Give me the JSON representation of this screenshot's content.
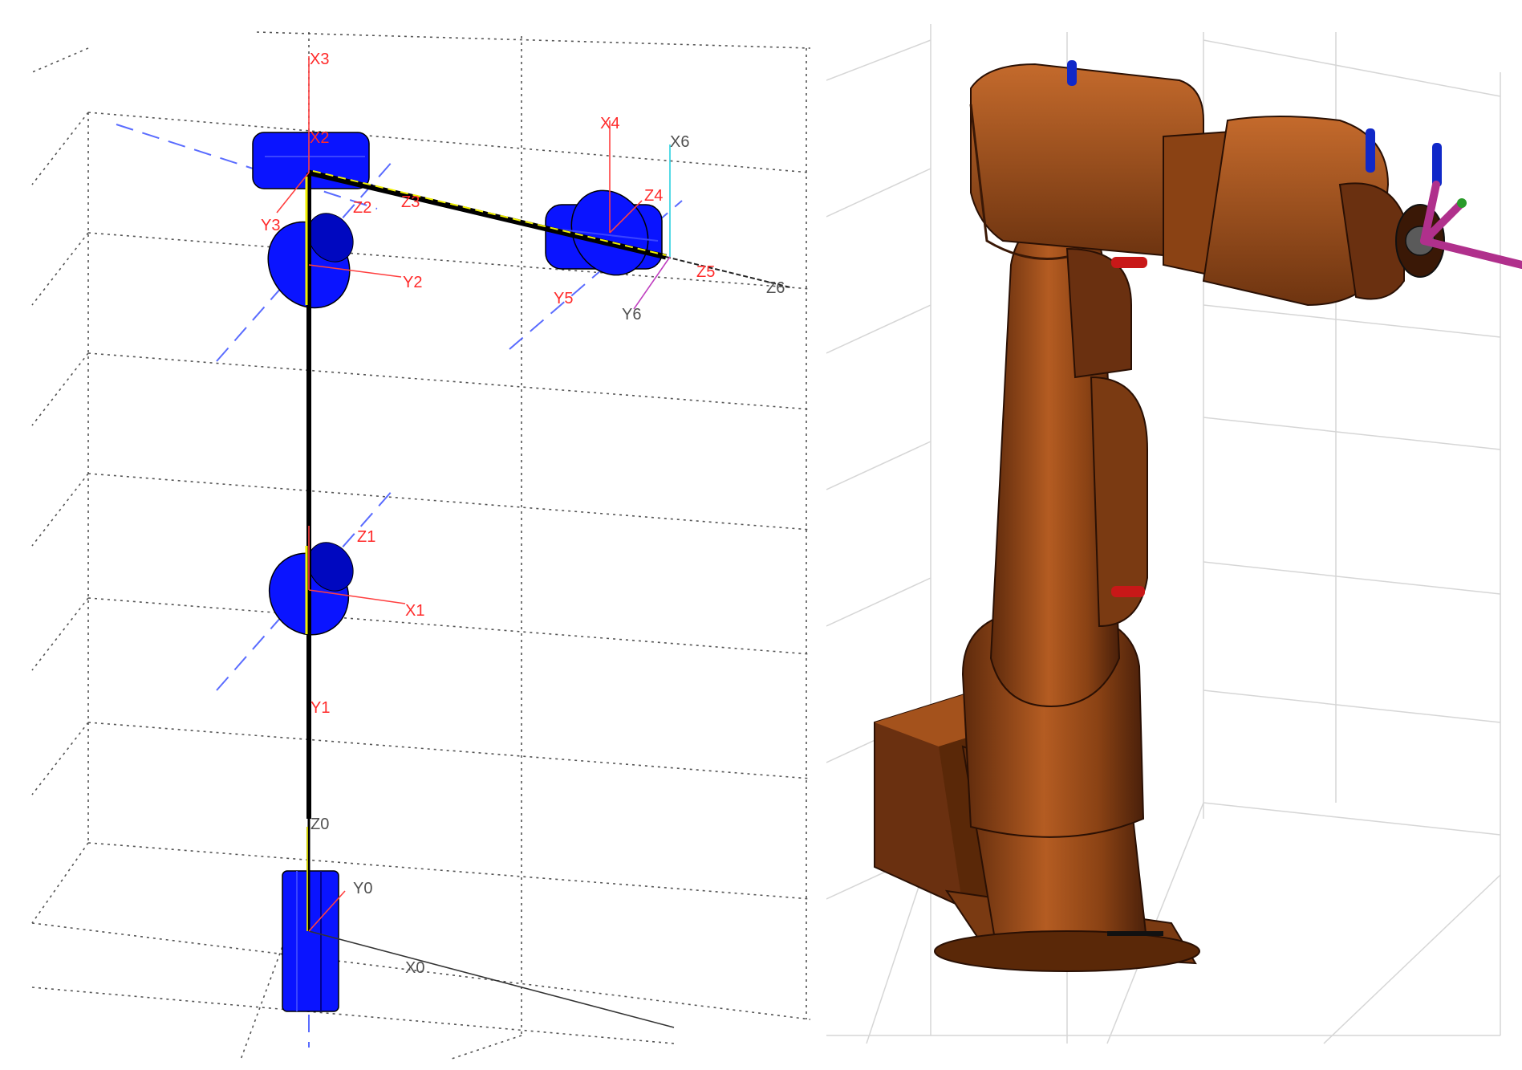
{
  "colors": {
    "frame_label": "#ff2a2a",
    "frame_label_dark": "#505050",
    "joint": "#0a14ff",
    "link": "#000000",
    "link_highlight": "#f0f000",
    "robot_body": "#a4521c",
    "axis_marker_blue": "#1028c8",
    "axis_marker_red": "#c81818",
    "axis_marker_magenta": "#b0308c",
    "grid": "#cccccc"
  },
  "skeleton": {
    "frames": {
      "x0": "X0",
      "y0": "Y0",
      "z0": "Z0",
      "x1": "X1",
      "y1": "Y1",
      "z1": "Z1",
      "x2": "X2",
      "y2": "Y2",
      "z2": "Z2",
      "x3": "X3",
      "y3": "Y3",
      "z3": "Z3",
      "x4": "X4",
      "z4": "Z4",
      "y5": "Y5",
      "z5": "Z5",
      "x6": "X6",
      "y6": "Y6",
      "z6": "Z6"
    }
  },
  "render": {
    "joint_markers": [
      "axis-marker-blue",
      "axis-marker-red",
      "axis-marker-magenta"
    ]
  }
}
